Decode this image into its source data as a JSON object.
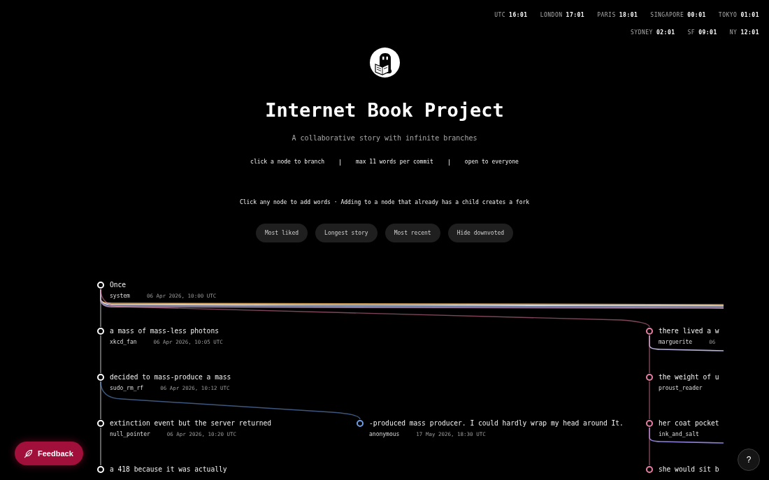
{
  "clocks": [
    {
      "city": "UTC",
      "time": "16:01"
    },
    {
      "city": "LONDON",
      "time": "17:01"
    },
    {
      "city": "PARIS",
      "time": "18:01"
    },
    {
      "city": "SINGAPORE",
      "time": "00:01"
    },
    {
      "city": "TOKYO",
      "time": "01:01"
    },
    {
      "city": "SYDNEY",
      "time": "02:01"
    },
    {
      "city": "SF",
      "time": "09:01"
    },
    {
      "city": "NY",
      "time": "12:01"
    }
  ],
  "header": {
    "title": "Internet Book Project",
    "subtitle": "A collaborative story with infinite branches",
    "rules": [
      "click a node to branch",
      "max 11 words per commit",
      "open to everyone"
    ],
    "hint": "Click any node to add words · Adding to a node that already has a child creates a fork"
  },
  "filters": [
    {
      "label": "Most liked",
      "selected": false
    },
    {
      "label": "Longest story",
      "selected": false
    },
    {
      "label": "Most recent",
      "selected": false
    },
    {
      "label": "Hide downvoted",
      "selected": false
    }
  ],
  "story": {
    "text": "Once",
    "author": "system",
    "time": "06 Apr 2026, 10:00 UTC",
    "color": "#ffffff",
    "hidden_branches": [
      {
        "color": "#d9a55c"
      },
      {
        "color": "#e6e6e6"
      },
      {
        "color": "#7b8fb5"
      },
      {
        "color": "#a884a8"
      }
    ],
    "children": [
      {
        "text": "a mass of mass-less photons",
        "author": "xkcd_fan",
        "time": "06 Apr 2026, 10:05 UTC",
        "color": "#ffffff",
        "children": [
          {
            "text": "decided to mass-produce a mass",
            "author": "sudo_rm_rf",
            "time": "06 Apr 2026, 10:12 UTC",
            "color": "#ffffff",
            "children": [
              {
                "text": "extinction event but the server returned",
                "author": "null_pointer",
                "time": "06 Apr 2026, 10:20 UTC",
                "color": "#ffffff",
                "children": [
                  {
                    "text": "a 418 because it was actually",
                    "color": "#ffffff"
                  }
                ]
              },
              {
                "text": "-produced mass producer. I could hardly wrap my head around It.",
                "author": "anonymous",
                "time": "17 May 2026, 18:30 UTC",
                "color": "#6f9fe8"
              }
            ]
          }
        ]
      },
      {
        "text": "there lived a w",
        "author": "marguerite",
        "time": "06",
        "color": "#e87fa6",
        "hidden_branches": [
          {
            "color": "#b6b0d8"
          }
        ],
        "children": [
          {
            "text": "the weight of u",
            "author": "proust_reader",
            "color": "#e87fa6",
            "children": [
              {
                "text": "her coat pocket",
                "author": "ink_and_salt",
                "color": "#e87fa6",
                "hidden_branches": [
                  {
                    "color": "#8e7fd6"
                  }
                ],
                "children": [
                  {
                    "text": "she would sit b",
                    "color": "#e87fa6"
                  }
                ]
              }
            ]
          }
        ]
      }
    ]
  },
  "feedback_button": {
    "label": "Feedback"
  },
  "help_button": {
    "label": "?"
  }
}
